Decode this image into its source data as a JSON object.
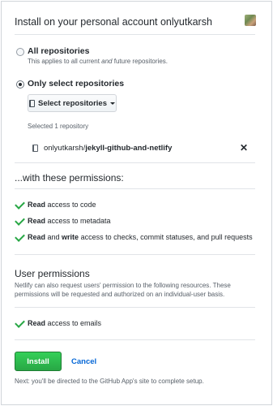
{
  "header": {
    "title": "Install on your personal account onlyutkarsh"
  },
  "repositories": {
    "all_label": "All repositories",
    "all_desc_prefix": "This applies to all current ",
    "all_desc_em": "and",
    "all_desc_suffix": " future repositories.",
    "only_label": "Only select repositories",
    "select_button": "Select repositories",
    "selected_count": "Selected 1 repository",
    "selected": {
      "owner": "onlyutkarsh/",
      "name": "jekyll-github-and-netlify",
      "remove": "✕"
    },
    "selected_option": "only"
  },
  "permissions": {
    "title": "...with these permissions:",
    "items": [
      {
        "bold1": "Read",
        "text1": " access to code",
        "bold2": "",
        "text2": ""
      },
      {
        "bold1": "Read",
        "text1": " access to metadata",
        "bold2": "",
        "text2": ""
      },
      {
        "bold1": "Read",
        "text1": " and ",
        "bold2": "write",
        "text2": " access to checks, commit statuses, and pull requests"
      }
    ]
  },
  "user_permissions": {
    "title": "User permissions",
    "description": "Netlify can also request users' permission to the following resources. These permissions will be requested and authorized on an individual-user basis.",
    "item_bold": "Read",
    "item_text": " access to emails"
  },
  "actions": {
    "install": "Install",
    "cancel": "Cancel",
    "next_note": "Next: you'll be directed to the GitHub App's site to complete setup."
  },
  "colors": {
    "accent_green": "#28a745",
    "link_blue": "#0366d6"
  }
}
